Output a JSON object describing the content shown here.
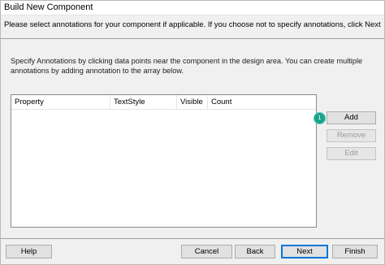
{
  "window": {
    "title": "Build New Component"
  },
  "instruction": "Please select annotations for your component if applicable.  If you choose not to specify annotations, click Next",
  "description": "Specify Annotations by clicking data points near the component in the design area.  You can create multiple annotations by adding annotation to the array below.",
  "grid": {
    "columns": [
      "Property",
      "TextStyle",
      "Visible",
      "Count"
    ],
    "rows": []
  },
  "side_buttons": {
    "add": "Add",
    "remove": "Remove",
    "edit": "Edit"
  },
  "badge": {
    "text": "1",
    "color": "#1ba28b"
  },
  "footer": {
    "help": "Help",
    "cancel": "Cancel",
    "back": "Back",
    "next": "Next",
    "finish": "Finish"
  },
  "colors": {
    "default_button_border": "#0078d7"
  }
}
